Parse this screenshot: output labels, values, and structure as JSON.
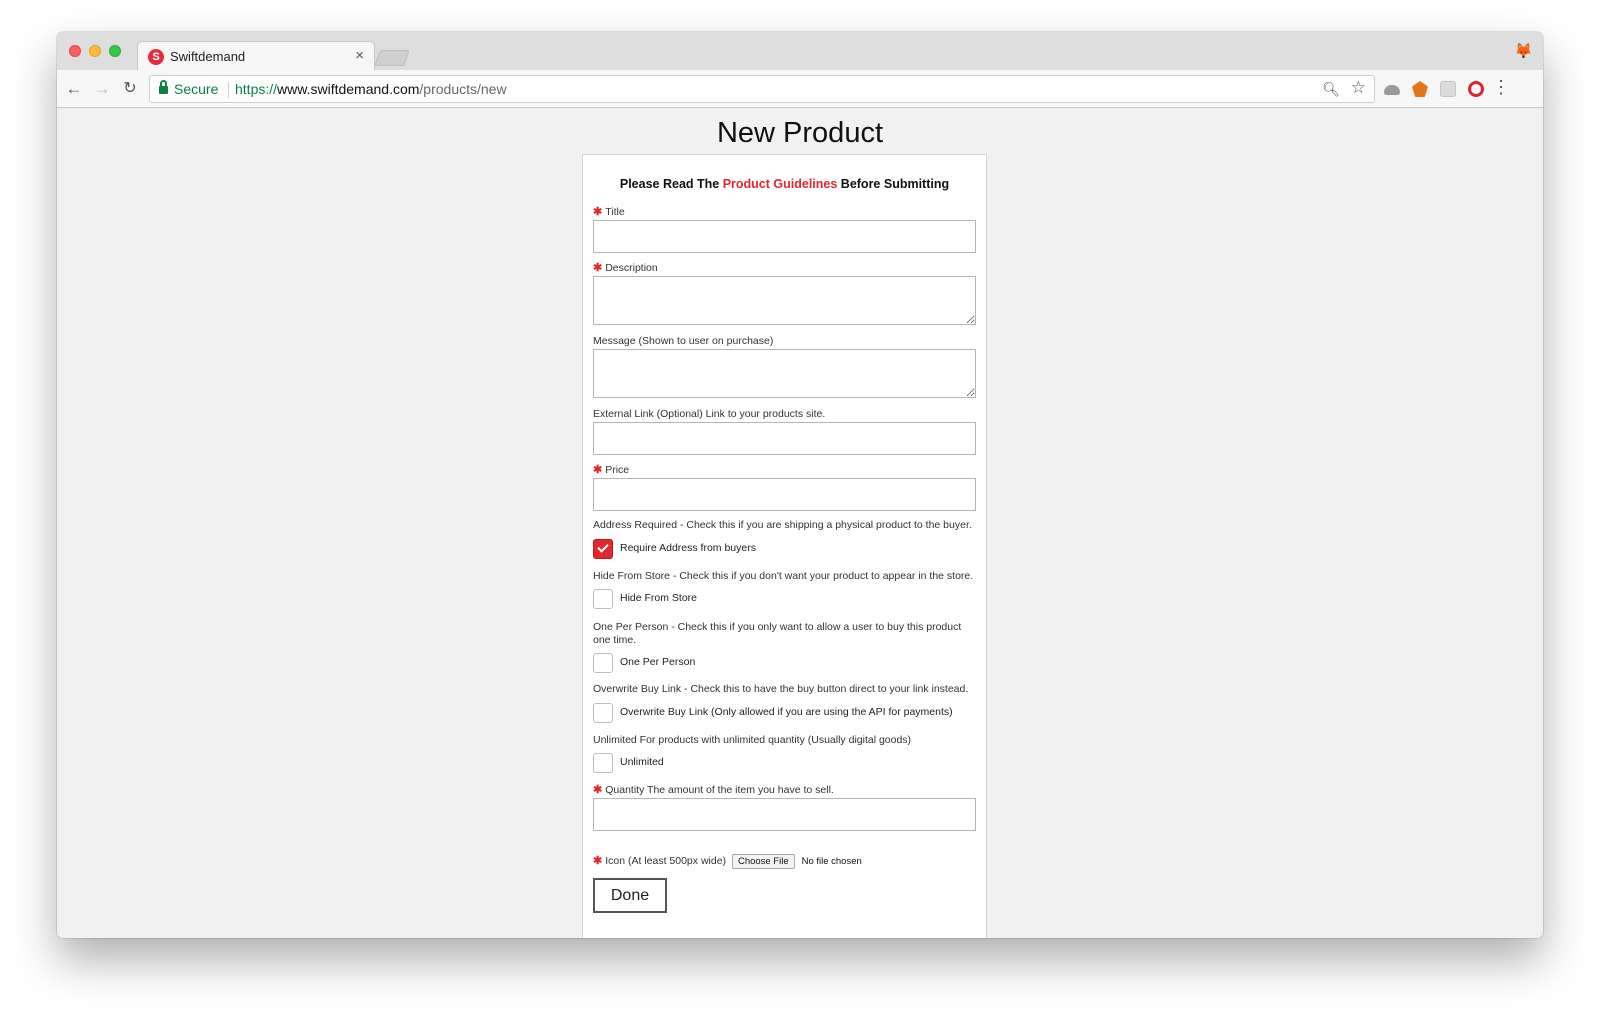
{
  "browser": {
    "tab_title": "Swiftdemand",
    "tab_favicon": "S",
    "tab_close": "×",
    "secure_label": "Secure",
    "url_scheme": "https://",
    "url_host": "www.swiftdemand.com",
    "url_path": "/products/new",
    "icons": [
      "back-arrow-icon",
      "forward-arrow-icon",
      "reload-icon",
      "lock-icon",
      "zoom-icon",
      "star-icon",
      "cloud-extension-icon",
      "metamask-fox-icon",
      "blank-extension-icon",
      "opera-icon",
      "menu-kebab-icon"
    ]
  },
  "page": {
    "title": "New Product",
    "guideline_prefix": "Please Read The ",
    "guideline_link": "Product Guidelines",
    "guideline_suffix": " Before Submitting",
    "required_mark": "✱",
    "fields": {
      "title": {
        "label": "Title",
        "value": ""
      },
      "description": {
        "label": "Description",
        "value": ""
      },
      "message": {
        "label": "Message (Shown to user on purchase)",
        "value": ""
      },
      "external_link": {
        "label": "External Link (Optional) Link to your products site.",
        "value": ""
      },
      "price": {
        "label": "Price",
        "value": ""
      },
      "quantity": {
        "label": "Quantity The amount of the item you have to sell.",
        "value": ""
      }
    },
    "checkbox_groups": {
      "address": {
        "description": "Address Required - Check this if you are shipping a physical product to the buyer.",
        "label": "Require Address from buyers",
        "checked": true
      },
      "hide": {
        "description": "Hide From Store - Check this if you don't want your product to appear in the store.",
        "label": "Hide From Store",
        "checked": false
      },
      "one_per": {
        "description": "One Per Person - Check this if you only want to allow a user to buy this product one time.",
        "label": "One Per Person",
        "checked": false
      },
      "overwrite": {
        "description": "Overwrite Buy Link - Check this to have the buy button direct to your link instead.",
        "label": "Overwrite Buy Link (Only allowed if you are using the API for payments)",
        "checked": false
      },
      "unlimited": {
        "description": "Unlimited For products with unlimited quantity (Usually digital goods)",
        "label": "Unlimited",
        "checked": false
      }
    },
    "icon_upload": {
      "label": "Icon (At least 500px wide)",
      "button": "Choose File",
      "status": "No file chosen"
    },
    "done_button": "Done"
  },
  "colors": {
    "accent_red": "#e0282f",
    "secure_green": "#0b8043"
  }
}
